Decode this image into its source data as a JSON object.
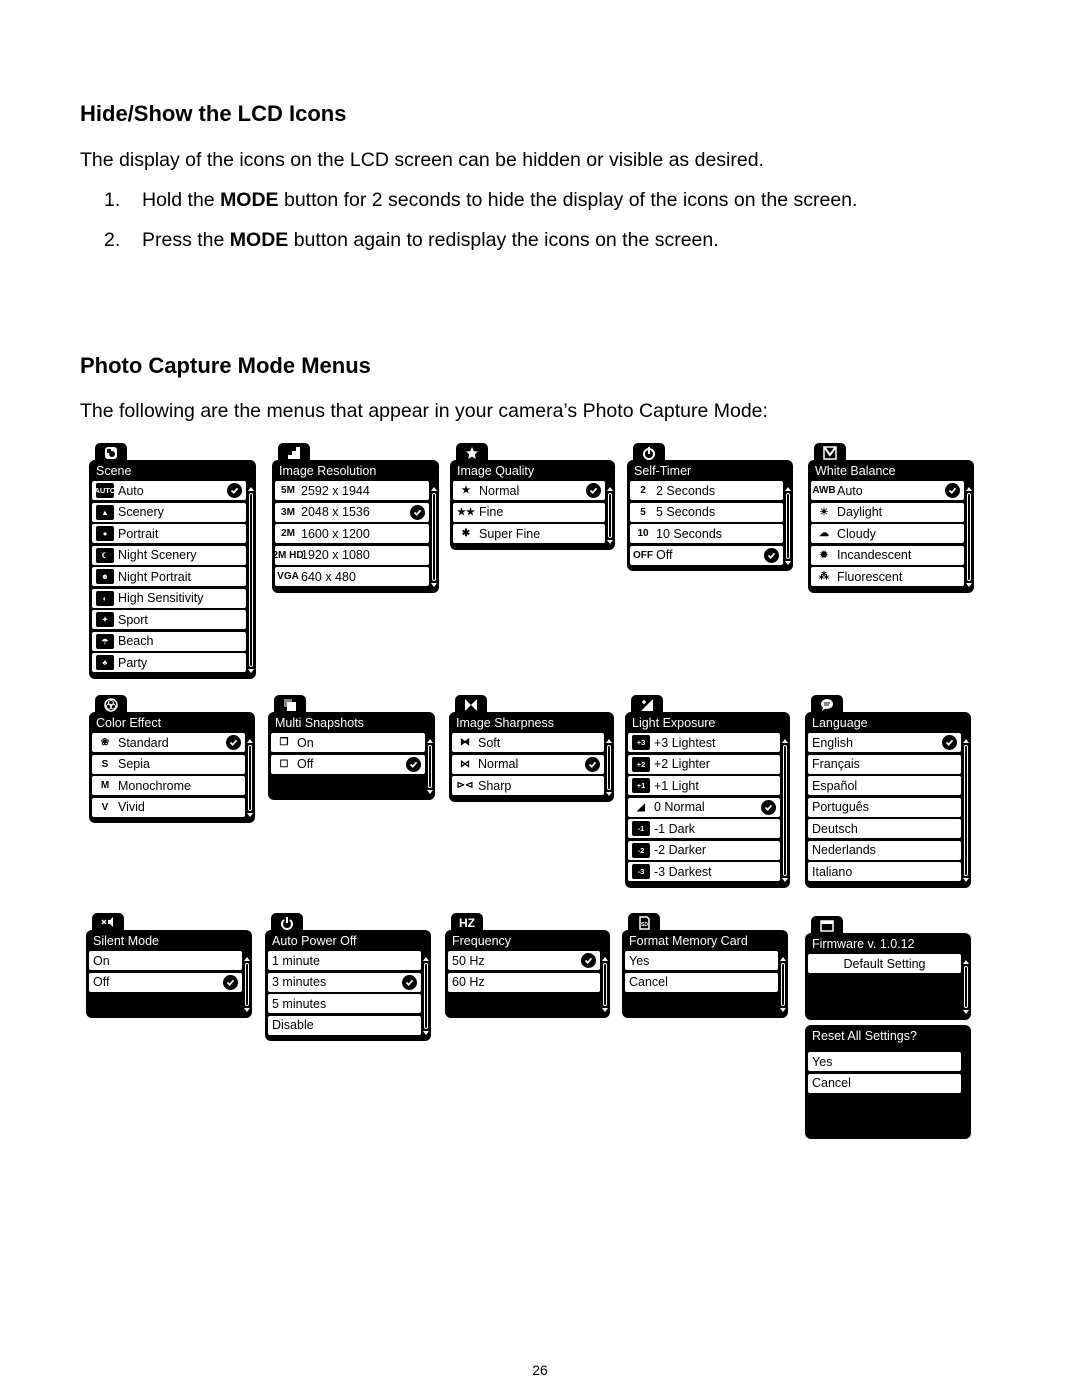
{
  "section1": {
    "heading": "Hide/Show the LCD Icons",
    "intro": "The display of the icons on the LCD screen can be hidden or visible as desired.",
    "steps": [
      {
        "num": "1.",
        "pre": "Hold the ",
        "bold": "MODE",
        "post": " button for 2 seconds to hide the display of the icons on the screen."
      },
      {
        "num": "2.",
        "pre": "Press the ",
        "bold": "MODE",
        "post": " button again to redisplay the icons on the screen."
      }
    ]
  },
  "section2": {
    "heading": "Photo Capture Mode Menus",
    "intro": "The following are the menus that appear in your camera’s Photo Capture Mode:"
  },
  "menus": [
    {
      "title": "Scene",
      "tab_icon": "scene-icon",
      "items": [
        {
          "label": "Auto",
          "icon": "AUTO",
          "selected": true
        },
        {
          "label": "Scenery",
          "icon": "▲"
        },
        {
          "label": "Portrait",
          "icon": "●"
        },
        {
          "label": "Night Scenery",
          "icon": "☾"
        },
        {
          "label": "Night Portrait",
          "icon": "☻"
        },
        {
          "label": "High Sensitivity",
          "icon": "◐"
        },
        {
          "label": "Sport",
          "icon": "✦"
        },
        {
          "label": "Beach",
          "icon": "☂"
        },
        {
          "label": "Party",
          "icon": "♣"
        }
      ]
    },
    {
      "title": "Image Resolution",
      "tab_icon": "resolution-icon",
      "items": [
        {
          "label": "2592 x 1944",
          "icon": "5M"
        },
        {
          "label": "2048 x 1536",
          "icon": "3M",
          "selected": true
        },
        {
          "label": "1600 x 1200",
          "icon": "2M"
        },
        {
          "label": "1920 x 1080",
          "icon": "2M HD"
        },
        {
          "label": "640 x 480",
          "icon": "VGA"
        }
      ]
    },
    {
      "title": "Image Quality",
      "tab_icon": "star-icon",
      "items": [
        {
          "label": "Normal",
          "icon": "★",
          "selected": true
        },
        {
          "label": "Fine",
          "icon": "★★"
        },
        {
          "label": "Super Fine",
          "icon": "✱"
        }
      ]
    },
    {
      "title": "Self-Timer",
      "tab_icon": "timer-icon",
      "items": [
        {
          "label": "2 Seconds",
          "icon": "2"
        },
        {
          "label": "5 Seconds",
          "icon": "5"
        },
        {
          "label": "10 Seconds",
          "icon": "10"
        },
        {
          "label": "Off",
          "icon": "OFF",
          "selected": true
        }
      ]
    },
    {
      "title": "White Balance",
      "tab_icon": "white-balance-icon",
      "items": [
        {
          "label": "Auto",
          "icon": "AWB",
          "selected": true
        },
        {
          "label": "Daylight",
          "icon": "☀"
        },
        {
          "label": "Cloudy",
          "icon": "☁"
        },
        {
          "label": "Incandescent",
          "icon": "✹"
        },
        {
          "label": "Fluorescent",
          "icon": "⁂"
        }
      ]
    },
    {
      "title": "Color Effect",
      "tab_icon": "color-effect-icon",
      "items": [
        {
          "label": "Standard",
          "icon": "❀",
          "selected": true
        },
        {
          "label": "Sepia",
          "icon": "S"
        },
        {
          "label": "Monochrome",
          "icon": "M"
        },
        {
          "label": "Vivid",
          "icon": "V"
        }
      ]
    },
    {
      "title": "Multi Snapshots",
      "tab_icon": "multi-snapshot-icon",
      "items": [
        {
          "label": "On",
          "icon": "❐"
        },
        {
          "label": "Off",
          "icon": "☐",
          "selected": true
        }
      ]
    },
    {
      "title": "Image Sharpness",
      "tab_icon": "sharpness-icon",
      "items": [
        {
          "label": "Soft",
          "icon": "⧓"
        },
        {
          "label": "Normal",
          "icon": "⋈",
          "selected": true
        },
        {
          "label": "Sharp",
          "icon": "⊳⊲"
        }
      ]
    },
    {
      "title": "Light Exposure",
      "tab_icon": "exposure-icon",
      "items": [
        {
          "label": "+3 Lightest",
          "icon": "+3"
        },
        {
          "label": "+2 Lighter",
          "icon": "+2"
        },
        {
          "label": "+1 Light",
          "icon": "+1"
        },
        {
          "label": "0 Normal",
          "icon": "◢",
          "selected": true
        },
        {
          "label": "-1 Dark",
          "icon": "-1"
        },
        {
          "label": "-2 Darker",
          "icon": "-2"
        },
        {
          "label": "-3 Darkest",
          "icon": "-3"
        }
      ]
    },
    {
      "title": "Language",
      "tab_icon": "language-icon",
      "items": [
        {
          "label": "English",
          "selected": true
        },
        {
          "label": "Français"
        },
        {
          "label": "Español"
        },
        {
          "label": "Português"
        },
        {
          "label": "Deutsch"
        },
        {
          "label": "Nederlands"
        },
        {
          "label": "Italiano"
        }
      ]
    },
    {
      "title": "Silent Mode",
      "tab_icon": "silent-icon",
      "items": [
        {
          "label": "On"
        },
        {
          "label": "Off",
          "selected": true
        }
      ]
    },
    {
      "title": "Auto Power Off",
      "tab_icon": "power-icon",
      "items": [
        {
          "label": "1 minute"
        },
        {
          "label": "3 minutes",
          "selected": true
        },
        {
          "label": "5 minutes"
        },
        {
          "label": "Disable"
        }
      ]
    },
    {
      "title": "Frequency",
      "tab_icon": "hz-icon",
      "tab_text": "HZ",
      "items": [
        {
          "label": "50 Hz",
          "selected": true
        },
        {
          "label": "60 Hz"
        }
      ]
    },
    {
      "title": "Format Memory Card",
      "tab_icon": "sd-card-icon",
      "items": [
        {
          "label": "Yes"
        },
        {
          "label": "Cancel"
        }
      ]
    },
    {
      "title": "Firmware v. 1.0.12",
      "tab_icon": "firmware-icon",
      "items": [
        {
          "label": "Default Setting",
          "centered": true
        }
      ]
    },
    {
      "title": "Reset All Settings?",
      "items": [
        {
          "label": "Yes"
        },
        {
          "label": "Cancel"
        }
      ]
    }
  ],
  "page_number": "26"
}
